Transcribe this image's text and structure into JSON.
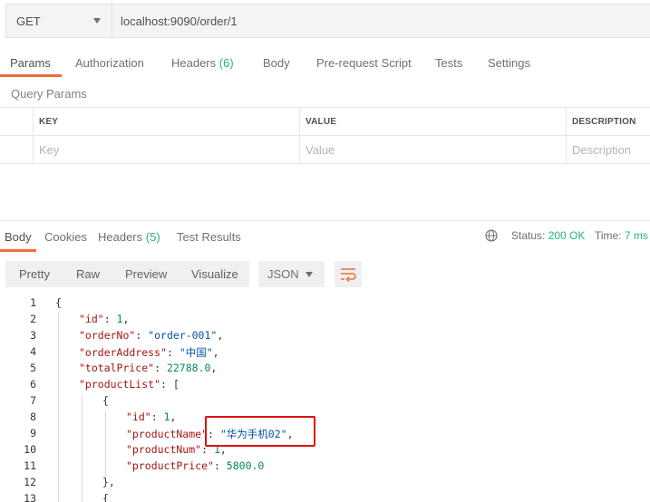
{
  "request": {
    "method": "GET",
    "url": "localhost:9090/order/1"
  },
  "request_tabs": [
    {
      "label": "Params",
      "count": ""
    },
    {
      "label": "Authorization",
      "count": ""
    },
    {
      "label": "Headers",
      "count": "(6)"
    },
    {
      "label": "Body",
      "count": ""
    },
    {
      "label": "Pre-request Script",
      "count": ""
    },
    {
      "label": "Tests",
      "count": ""
    },
    {
      "label": "Settings",
      "count": ""
    }
  ],
  "query_params": {
    "title": "Query Params",
    "columns": [
      "KEY",
      "VALUE",
      "DESCRIPTION"
    ],
    "placeholders": [
      "Key",
      "Value",
      "Description"
    ]
  },
  "response_tabs": [
    {
      "label": "Body",
      "count": ""
    },
    {
      "label": "Cookies",
      "count": ""
    },
    {
      "label": "Headers",
      "count": "(5)"
    },
    {
      "label": "Test Results",
      "count": ""
    }
  ],
  "status": {
    "status_label": "Status:",
    "status_value": "200 OK",
    "time_label": "Time:",
    "time_value": "7 ms"
  },
  "view_modes": [
    "Pretty",
    "Raw",
    "Preview",
    "Visualize"
  ],
  "format": "JSON",
  "code_lines": [
    {
      "num": "1"
    },
    {
      "num": "2"
    },
    {
      "num": "3"
    },
    {
      "num": "4"
    },
    {
      "num": "5"
    },
    {
      "num": "6"
    },
    {
      "num": "7"
    },
    {
      "num": "8"
    },
    {
      "num": "9"
    },
    {
      "num": "10"
    },
    {
      "num": "11"
    },
    {
      "num": "12"
    },
    {
      "num": "13"
    }
  ],
  "json": {
    "k_id": "\"id\"",
    "v_id": "1",
    "k_orderNo": "\"orderNo\"",
    "v_orderNo": "\"order-001\"",
    "k_orderAddress": "\"orderAddress\"",
    "v_orderAddress": "\"中国\"",
    "k_totalPrice": "\"totalPrice\"",
    "v_totalPrice": "22788.0",
    "k_productList": "\"productList\"",
    "k_p_id": "\"id\"",
    "v_p_id": "1",
    "k_productName": "\"productName\"",
    "v_productName": "\"华为手机02\"",
    "k_productNum": "\"productNum\"",
    "v_productNum": "1",
    "k_productPrice": "\"productPrice\"",
    "v_productPrice": "5800.0"
  },
  "colors": {
    "accent": "#f26b3a",
    "success": "#26b47f",
    "highlight": "#e01010"
  }
}
